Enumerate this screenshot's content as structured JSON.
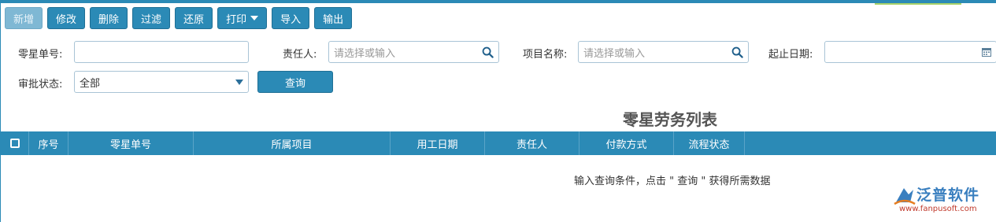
{
  "toolbar": {
    "add": "新增",
    "edit": "修改",
    "delete": "删除",
    "filter": "过滤",
    "restore": "还原",
    "print": "打印",
    "import": "导入",
    "export": "输出"
  },
  "filters": {
    "order_no_label": "零星单号:",
    "order_no_value": "",
    "owner_label": "责任人:",
    "owner_placeholder": "请选择或输入",
    "project_label": "项目名称:",
    "project_placeholder": "请选择或输入",
    "date_label": "起止日期:",
    "date_value": "",
    "status_label": "审批状态:",
    "status_value": "全部",
    "query_button": "查询"
  },
  "list": {
    "title": "零星劳务列表",
    "columns": [
      "序号",
      "零星单号",
      "所属项目",
      "用工日期",
      "责任人",
      "付款方式",
      "流程状态"
    ],
    "empty_message": "输入查询条件，点击 \" 查询 \" 获得所需数据"
  },
  "brand": {
    "name": "泛普软件",
    "url": "www.fanpusoft.com",
    "accent": "#2b8ab6"
  }
}
